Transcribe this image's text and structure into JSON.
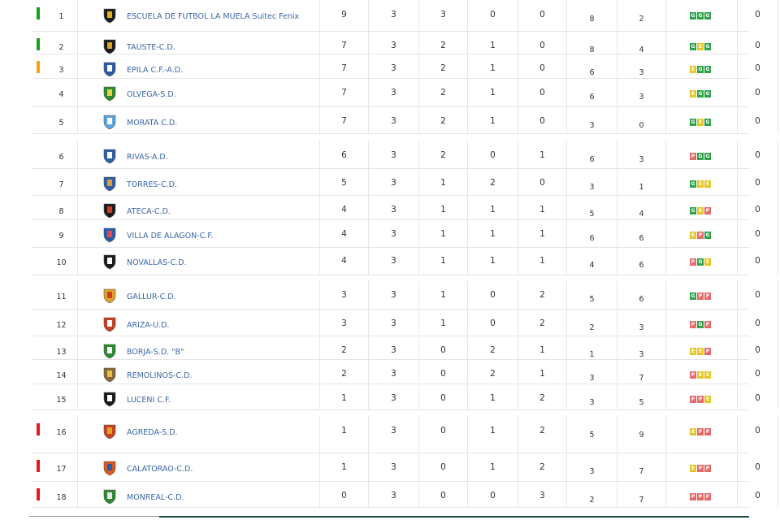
{
  "colors": {
    "promotion": "#1aa31a",
    "playoff": "#f5a40a",
    "relegation": "#e61a1a"
  },
  "rows": [
    {
      "pos": "1",
      "team": "ESCUELA DE FUTBOL LA MUELA Suitec Fenix",
      "pts": "9",
      "pj": "3",
      "pg": "3",
      "pe": "0",
      "pp": "0",
      "gf": "8",
      "gc": "2",
      "form": [
        "G",
        "G",
        "G"
      ],
      "sanc": "0",
      "zone": "promotion",
      "icon": "black-shield-crest-icon"
    },
    {
      "pos": "2",
      "team": "TAUSTE-C.D.",
      "pts": "7",
      "pj": "3",
      "pg": "2",
      "pe": "1",
      "pp": "0",
      "gf": "8",
      "gc": "4",
      "form": [
        "G",
        "E",
        "G"
      ],
      "sanc": "0",
      "zone": "promotion",
      "icon": "striped-shield-crest-icon"
    },
    {
      "pos": "3",
      "team": "EPILA C.F.-A.D.",
      "pts": "7",
      "pj": "3",
      "pg": "2",
      "pe": "1",
      "pp": "0",
      "gf": "6",
      "gc": "3",
      "form": [
        "E",
        "G",
        "G"
      ],
      "sanc": "0",
      "zone": "playoff",
      "icon": "blue-white-crest-icon"
    },
    {
      "pos": "4",
      "team": "OLVEGA-S.D.",
      "pts": "7",
      "pj": "3",
      "pg": "2",
      "pe": "1",
      "pp": "0",
      "gf": "6",
      "gc": "3",
      "form": [
        "E",
        "G",
        "G"
      ],
      "sanc": "0",
      "zone": "none",
      "icon": "green-shield-crest-icon"
    },
    {
      "pos": "5",
      "team": "MORATA C.D.",
      "pts": "7",
      "pj": "3",
      "pg": "2",
      "pe": "1",
      "pp": "0",
      "gf": "3",
      "gc": "0",
      "form": [
        "G",
        "E",
        "G"
      ],
      "sanc": "0",
      "zone": "none",
      "icon": "sky-blue-crest-icon"
    },
    {
      "pos": "6",
      "team": "RIVAS-A.D.",
      "pts": "6",
      "pj": "3",
      "pg": "2",
      "pe": "0",
      "pp": "1",
      "gf": "6",
      "gc": "3",
      "form": [
        "P",
        "G",
        "G"
      ],
      "sanc": "0",
      "zone": "none",
      "icon": "blue-stripes-crest-icon"
    },
    {
      "pos": "7",
      "team": "TORRES-C.D.",
      "pts": "5",
      "pj": "3",
      "pg": "1",
      "pe": "2",
      "pp": "0",
      "gf": "3",
      "gc": "1",
      "form": [
        "G",
        "E",
        "E"
      ],
      "sanc": "0",
      "zone": "none",
      "icon": "tower-crest-icon"
    },
    {
      "pos": "8",
      "team": "ATECA-C.D.",
      "pts": "4",
      "pj": "3",
      "pg": "1",
      "pe": "1",
      "pp": "1",
      "gf": "5",
      "gc": "4",
      "form": [
        "G",
        "E",
        "P"
      ],
      "sanc": "0",
      "zone": "none",
      "icon": "square-crest-icon"
    },
    {
      "pos": "9",
      "team": "VILLA DE ALAGON-C.F.",
      "pts": "4",
      "pj": "3",
      "pg": "1",
      "pe": "1",
      "pp": "1",
      "gf": "6",
      "gc": "6",
      "form": [
        "E",
        "P",
        "G"
      ],
      "sanc": "0",
      "zone": "none",
      "icon": "blue-red-shield-crest-icon"
    },
    {
      "pos": "10",
      "team": "NOVALLAS-C.D.",
      "pts": "4",
      "pj": "3",
      "pg": "1",
      "pe": "1",
      "pp": "1",
      "gf": "4",
      "gc": "6",
      "form": [
        "P",
        "G",
        "E"
      ],
      "sanc": "0",
      "zone": "none",
      "icon": "black-white-crest-icon"
    },
    {
      "pos": "11",
      "team": "GALLUR-C.D.",
      "pts": "3",
      "pj": "3",
      "pg": "1",
      "pe": "0",
      "pp": "2",
      "gf": "5",
      "gc": "6",
      "form": [
        "G",
        "P",
        "P"
      ],
      "sanc": "0",
      "zone": "none",
      "icon": "gold-shield-crest-icon"
    },
    {
      "pos": "12",
      "team": "ARIZA-U.D.",
      "pts": "3",
      "pj": "3",
      "pg": "1",
      "pe": "0",
      "pp": "2",
      "gf": "2",
      "gc": "3",
      "form": [
        "P",
        "G",
        "P"
      ],
      "sanc": "0",
      "zone": "none",
      "icon": "red-white-crest-icon"
    },
    {
      "pos": "13",
      "team": "BORJA-S.D. \"B\"",
      "pts": "2",
      "pj": "3",
      "pg": "0",
      "pe": "2",
      "pp": "1",
      "gf": "1",
      "gc": "3",
      "form": [
        "E",
        "E",
        "P"
      ],
      "sanc": "0",
      "zone": "none",
      "icon": "green-white-crest-icon"
    },
    {
      "pos": "14",
      "team": "REMOLINOS-C.D.",
      "pts": "2",
      "pj": "3",
      "pg": "0",
      "pe": "2",
      "pp": "1",
      "gf": "3",
      "gc": "7",
      "form": [
        "P",
        "E",
        "E"
      ],
      "sanc": "0",
      "zone": "none",
      "icon": "small-crest-icon"
    },
    {
      "pos": "15",
      "team": "LUCENI C.F.",
      "pts": "1",
      "pj": "3",
      "pg": "0",
      "pe": "1",
      "pp": "2",
      "gf": "3",
      "gc": "5",
      "form": [
        "P",
        "P",
        "E"
      ],
      "sanc": "0",
      "zone": "none",
      "icon": "black-white-stripes-crest-icon"
    },
    {
      "pos": "16",
      "team": "AGREDA-S.D.",
      "pts": "1",
      "pj": "3",
      "pg": "0",
      "pe": "1",
      "pp": "2",
      "gf": "5",
      "gc": "9",
      "form": [
        "E",
        "P",
        "P"
      ],
      "sanc": "0",
      "zone": "relegation",
      "icon": "crowned-shield-crest-icon"
    },
    {
      "pos": "17",
      "team": "CALATORAO-C.D.",
      "pts": "1",
      "pj": "3",
      "pg": "0",
      "pe": "1",
      "pp": "2",
      "gf": "3",
      "gc": "7",
      "form": [
        "E",
        "P",
        "P"
      ],
      "sanc": "0",
      "zone": "relegation",
      "icon": "orange-blue-crest-icon"
    },
    {
      "pos": "18",
      "team": "MONREAL-C.D.",
      "pts": "0",
      "pj": "3",
      "pg": "0",
      "pe": "0",
      "pp": "3",
      "gf": "2",
      "gc": "7",
      "form": [
        "P",
        "P",
        "P"
      ],
      "sanc": "0",
      "zone": "relegation",
      "icon": "green-round-crest-icon"
    }
  ]
}
